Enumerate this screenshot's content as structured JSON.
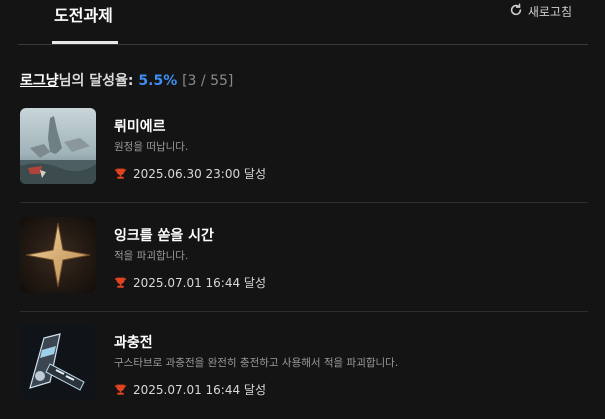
{
  "tabs": {
    "active_label": "도전과제"
  },
  "refresh": {
    "label": "새로고침",
    "icon": "refresh-icon"
  },
  "summary": {
    "nickname": "로그냥",
    "suffix": "님의 달성율: ",
    "percent": "5.5%",
    "count": "[3 / 55]"
  },
  "colors": {
    "accent": "#3d8ef0",
    "trophy": "#e0431f",
    "background": "#141414"
  },
  "achievements": [
    {
      "title": "뤼미에르",
      "description": "원정을 떠납니다.",
      "date": "2025.06.30 23:00 달성",
      "icon": "trophy-icon"
    },
    {
      "title": "잉크를 쏟을 시간",
      "description": "적을 파괴합니다.",
      "date": "2025.07.01 16:44 달성",
      "icon": "trophy-icon"
    },
    {
      "title": "과충전",
      "description": "구스타브로 과충전을 완전히 충전하고 사용해서 적을 파괴합니다.",
      "date": "2025.07.01 16:44 달성",
      "icon": "trophy-icon"
    }
  ]
}
